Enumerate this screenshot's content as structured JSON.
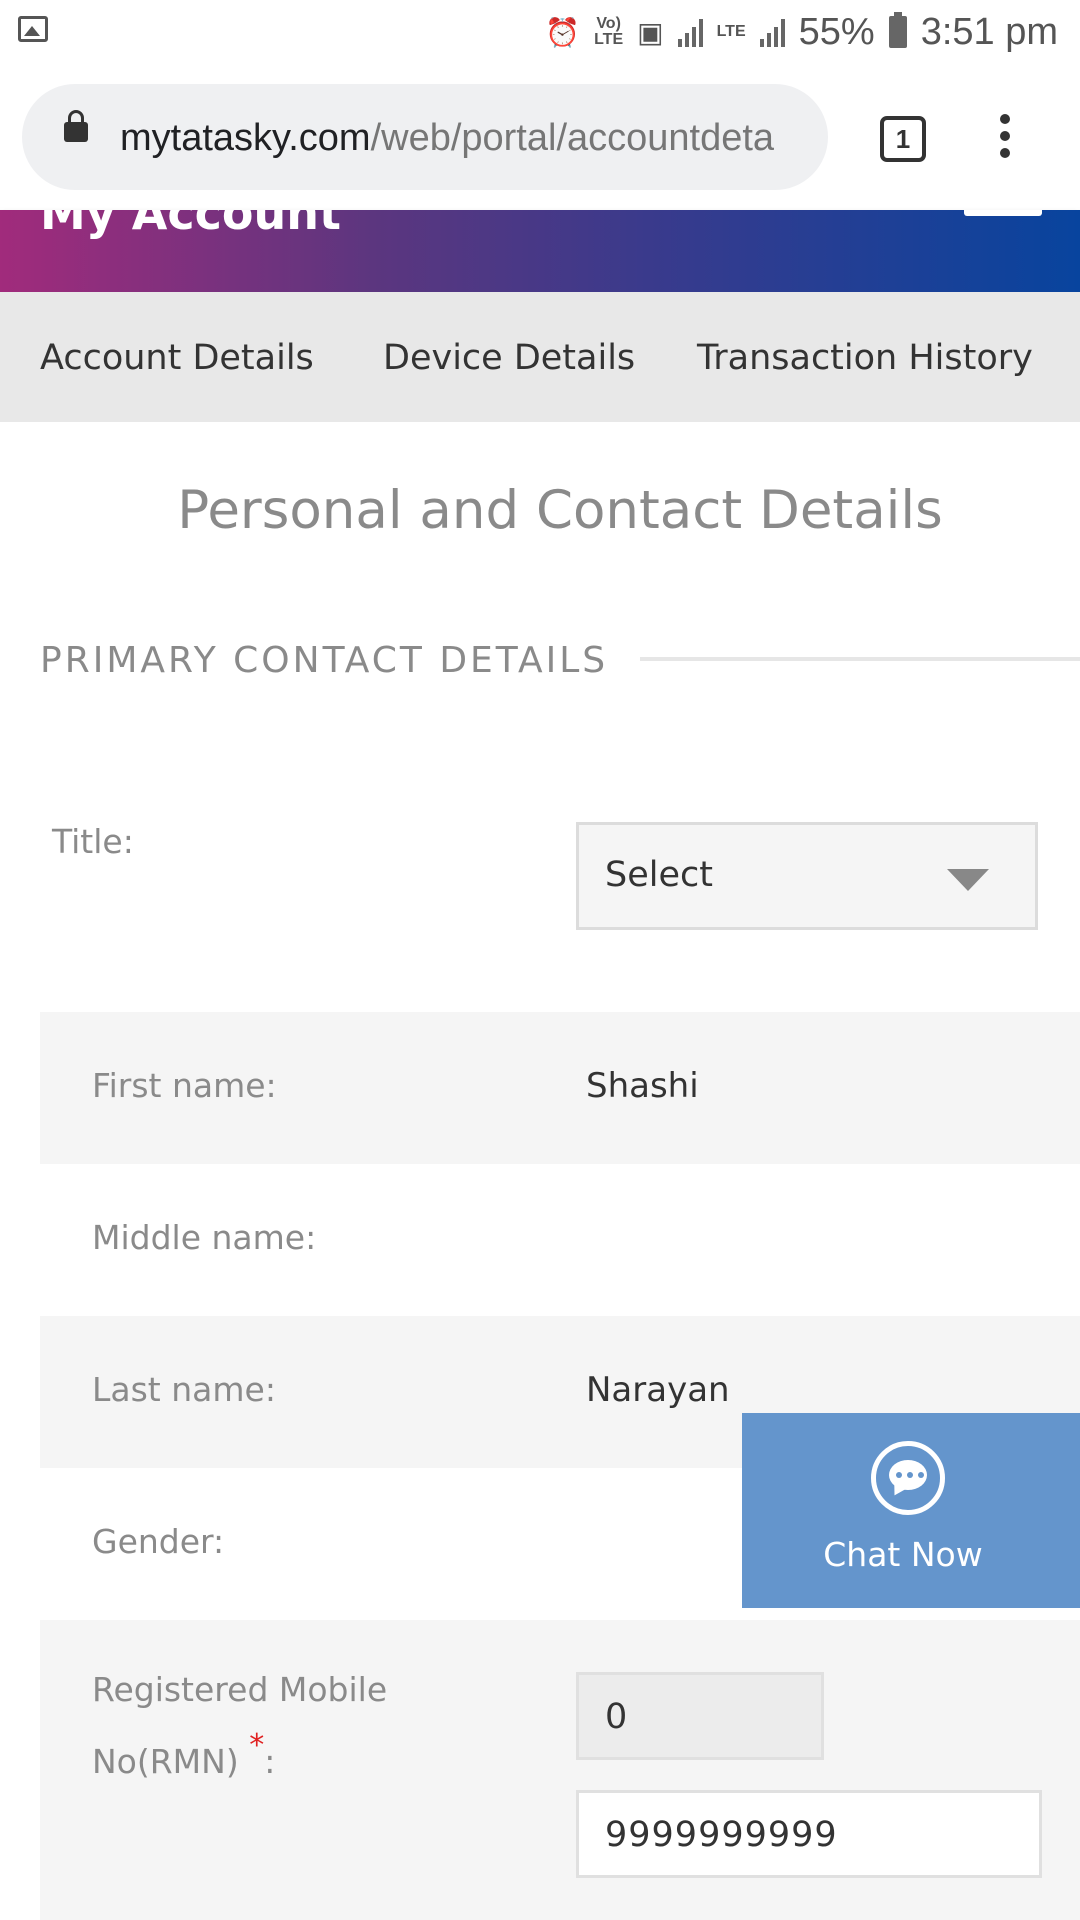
{
  "status_bar": {
    "battery": "55%",
    "time": "3:51 pm",
    "volte_label": "Vo) LTE",
    "lte_label": "LTE"
  },
  "browser": {
    "url_host": "mytatasky.com",
    "url_path": "/web/portal/accountdeta",
    "tab_count": "1"
  },
  "header": {
    "title": "My Account"
  },
  "nav": {
    "tabs": [
      {
        "label": "Account Details"
      },
      {
        "label": "Device Details"
      },
      {
        "label": "Transaction History"
      }
    ]
  },
  "page": {
    "title": "Personal and Contact Details",
    "section_heading": "PRIMARY CONTACT DETAILS"
  },
  "form": {
    "title_label": "Title:",
    "title_select_value": "Select",
    "first_name_label": "First name:",
    "first_name_value": "Shashi",
    "middle_name_label": "Middle name:",
    "middle_name_value": "",
    "last_name_label": "Last name:",
    "last_name_value": "Narayan",
    "gender_label": "Gender:",
    "rmn_label_line1": "Registered Mobile",
    "rmn_label_line2": "No(RMN)",
    "rmn_required_mark": "*",
    "rmn_colon": ":",
    "rmn_code_value": "0",
    "rmn_number_value": "9999999999"
  },
  "chat": {
    "label": "Chat Now"
  },
  "colors": {
    "header_gradient_start": "#a12b7c",
    "header_gradient_end": "#08449e",
    "chat_bg": "#6495cc",
    "required": "#e02020"
  }
}
